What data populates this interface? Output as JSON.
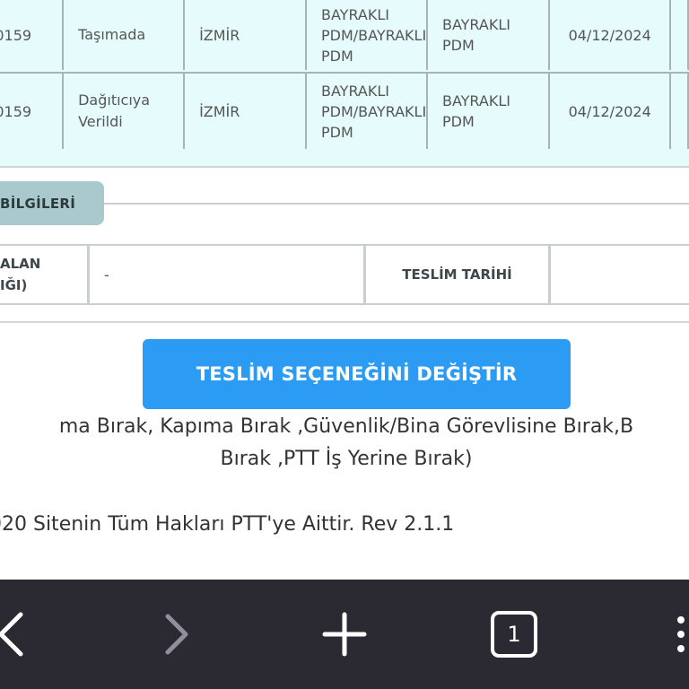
{
  "movements": [
    {
      "code": "0159",
      "islem": "Taşımada",
      "il": "İZMİR",
      "merkez": [
        "BAYRAKLI",
        "PDM/BAYRAKLI",
        "PDM"
      ],
      "birim": [
        "BAYRAKLI",
        "PDM"
      ],
      "tarih": "04/12/2024"
    },
    {
      "code": "0159",
      "islem": [
        "Dağıtıcıya",
        "Verildi"
      ],
      "il": "İZMİR",
      "merkez": [
        "BAYRAKLI",
        "PDM/BAYRAKLI",
        "PDM"
      ],
      "birim": [
        "BAYRAKLI",
        "PDM"
      ],
      "tarih": "04/12/2024"
    }
  ],
  "section": {
    "title": "BİLGİLERİ"
  },
  "delivery": {
    "label1_line1": "ALAN",
    "label1_line2": "IĞI)",
    "value1": "-",
    "label2": "TESLİM TARİHİ",
    "value2": ""
  },
  "change_button": {
    "label": "TESLİM SEÇENEĞİNİ DEĞİŞTİR"
  },
  "options_text": {
    "line1": "ma Bırak, Kapıma Bırak ,Güvenlik/Bina Görevlisine Bırak,B",
    "line2": "Bırak ,PTT İş Yerine Bırak)"
  },
  "footer": {
    "copyright": "020 Sitenin Tüm Hakları PTT'ye Aittir. Rev 2.1.1"
  },
  "toolbar": {
    "tab_count": "1",
    "icons": [
      "back-arrow-icon",
      "forward-arrow-icon",
      "plus-icon",
      "tab-counter",
      "menu-dots-icon"
    ],
    "colors": {
      "background": "#2b2a33",
      "active_icon": "#ffffff",
      "disabled_icon": "#8f8f9d"
    }
  },
  "colors": {
    "table_bg": "#e6fbfb",
    "section_tab_bg": "#aac9cd",
    "button_bg": "#2b9bf4"
  }
}
